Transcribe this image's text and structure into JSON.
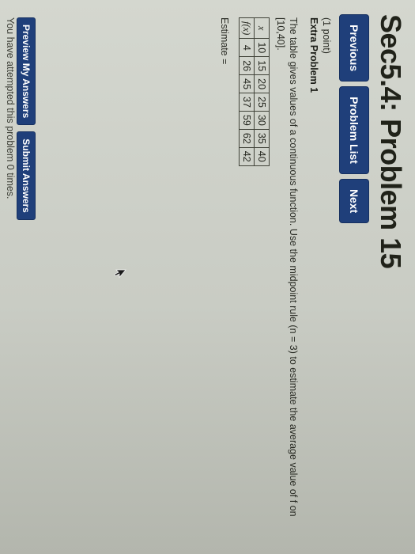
{
  "header": {
    "title": "Sec5.4: Problem 15"
  },
  "nav": {
    "previous_label": "Previous",
    "problem_list_label": "Problem List",
    "next_label": "Next"
  },
  "problem": {
    "points": "(1 point)",
    "section_title": "Extra Problem 1",
    "text": "The table gives values of a continuous function. Use the midpoint rule (n = 3) to estimate the average value of f on [10,40].",
    "table": {
      "x_label": "x",
      "fx_label": "f(x)",
      "x_values": [
        "10",
        "15",
        "20",
        "25",
        "30",
        "35",
        "40"
      ],
      "fx_values": [
        "4",
        "26",
        "45",
        "37",
        "59",
        "62",
        "42"
      ]
    },
    "estimate_label": "Estimate =",
    "estimate_value": ""
  },
  "actions": {
    "preview_label": "Preview My Answers",
    "submit_label": "Submit Answers"
  },
  "status": {
    "attempts_text": "You have attempted this problem 0 times."
  },
  "colors": {
    "button_blue": "#1f3f7a",
    "page_bg": "#c9ccc4"
  }
}
